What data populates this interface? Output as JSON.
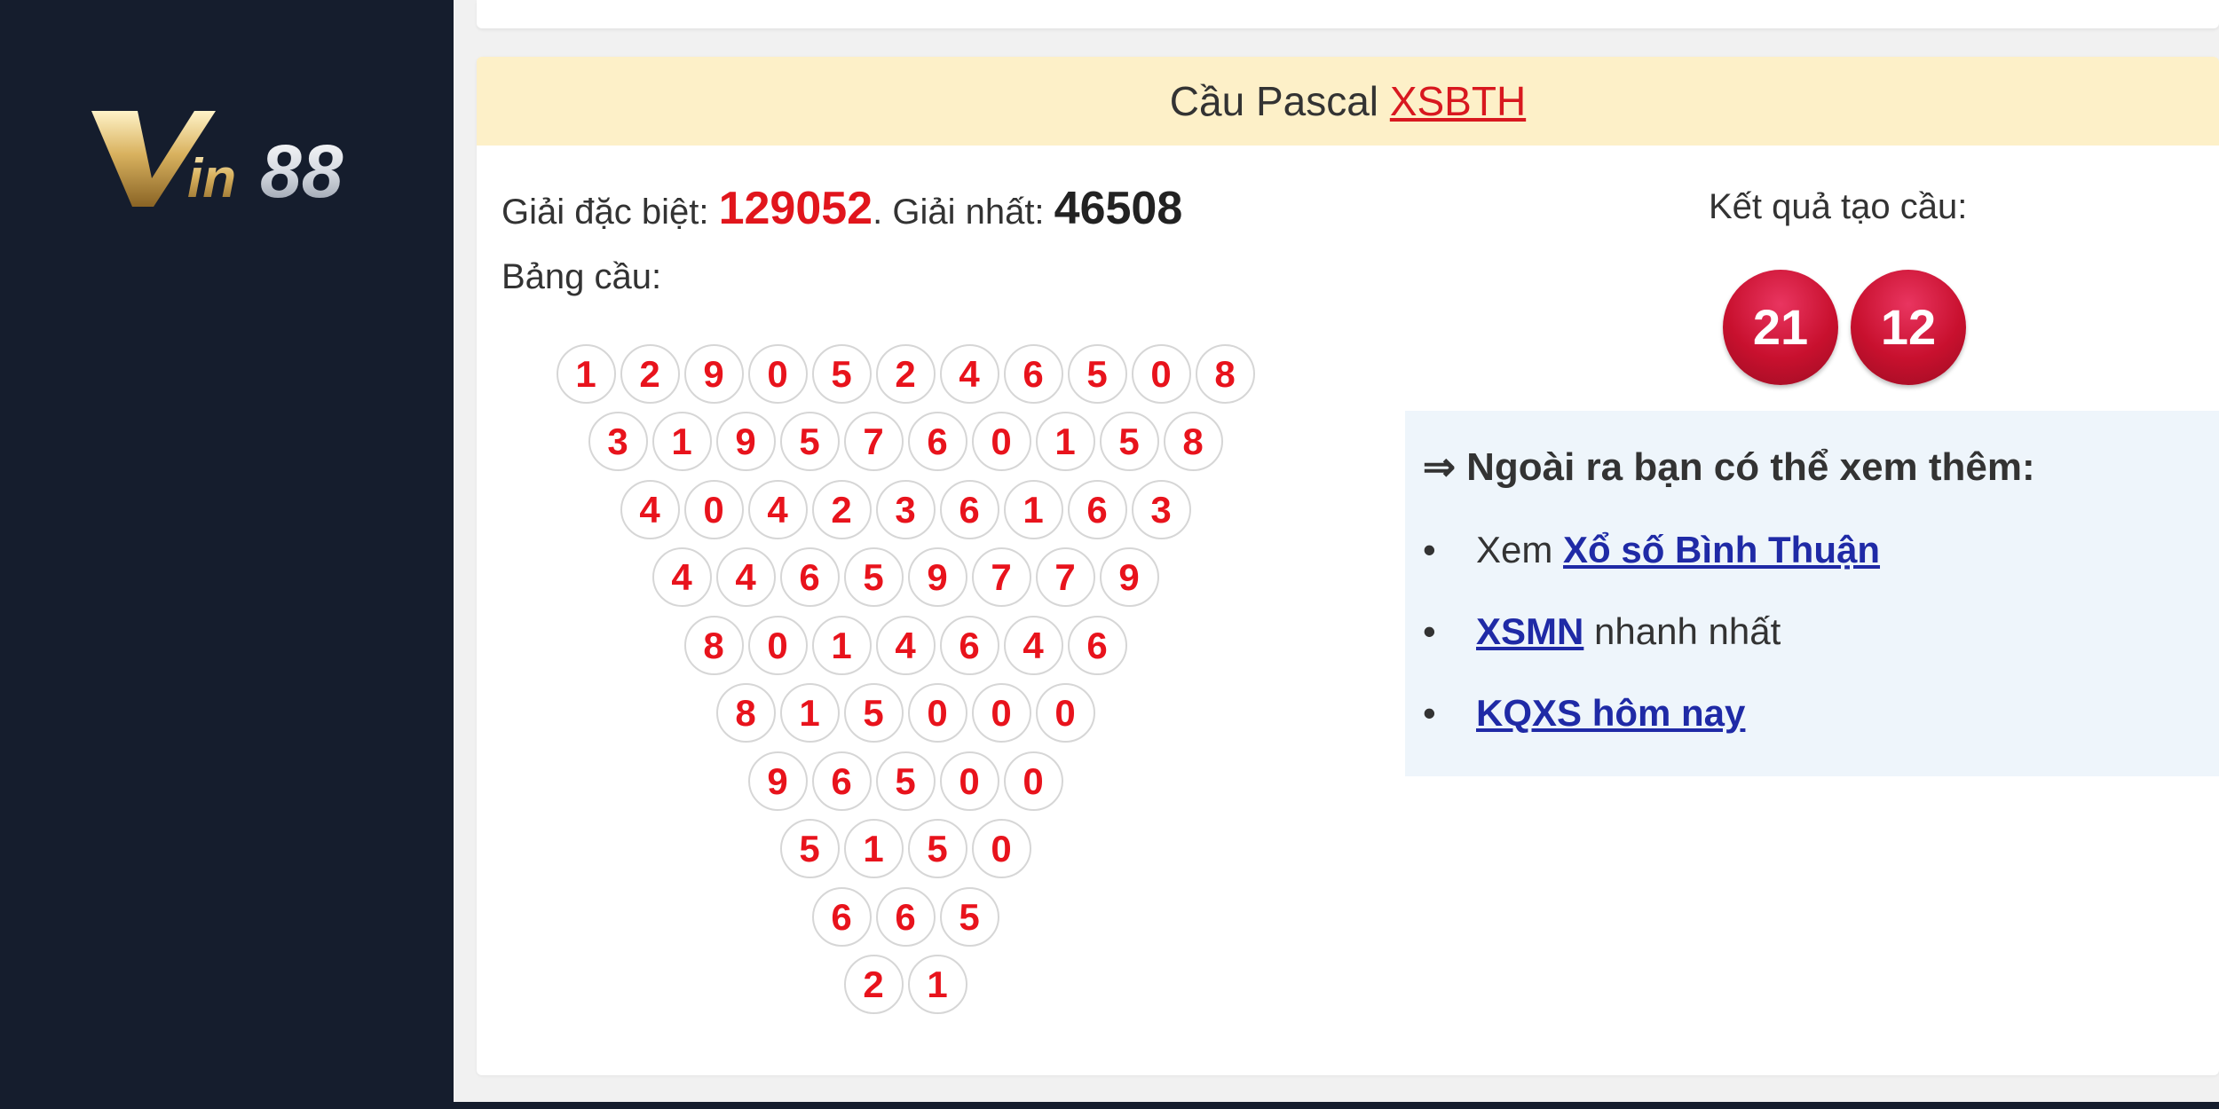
{
  "logo": {
    "text": "Vin88",
    "part1": "V",
    "part2": "in",
    "part3": "88"
  },
  "card": {
    "title_prefix": "Cầu Pascal ",
    "title_link": "XSBTH"
  },
  "prize": {
    "special_label": "Giải đặc biệt: ",
    "special_value": "129052",
    "sep": ". Giải nhất: ",
    "first_value": "46508"
  },
  "table_label": "Bảng cầu:",
  "triangle": [
    [
      "1",
      "2",
      "9",
      "0",
      "5",
      "2",
      "4",
      "6",
      "5",
      "0",
      "8"
    ],
    [
      "3",
      "1",
      "9",
      "5",
      "7",
      "6",
      "0",
      "1",
      "5",
      "8"
    ],
    [
      "4",
      "0",
      "4",
      "2",
      "3",
      "6",
      "1",
      "6",
      "3"
    ],
    [
      "4",
      "4",
      "6",
      "5",
      "9",
      "7",
      "7",
      "9"
    ],
    [
      "8",
      "0",
      "1",
      "4",
      "6",
      "4",
      "6"
    ],
    [
      "8",
      "1",
      "5",
      "0",
      "0",
      "0"
    ],
    [
      "9",
      "6",
      "5",
      "0",
      "0"
    ],
    [
      "5",
      "1",
      "5",
      "0"
    ],
    [
      "6",
      "6",
      "5"
    ],
    [
      "2",
      "1"
    ]
  ],
  "result": {
    "label": "Kết quả tạo cầu:",
    "balls": [
      "21",
      "12"
    ]
  },
  "more": {
    "title": "⇒ Ngoài ra bạn có thể xem thêm:",
    "items": [
      {
        "prefix": "Xem ",
        "link": "Xổ số Bình Thuận",
        "suffix": ""
      },
      {
        "prefix": "",
        "link": "XSMN",
        "suffix": " nhanh nhất"
      },
      {
        "prefix": "",
        "link": "KQXS hôm nay",
        "suffix": ""
      }
    ]
  },
  "colors": {
    "sidebar": "#151d2d",
    "header_bg": "#fdf0c8",
    "accent_red": "#e1151c",
    "link_blue": "#1f2aa6",
    "info_box": "#eef5fb"
  }
}
